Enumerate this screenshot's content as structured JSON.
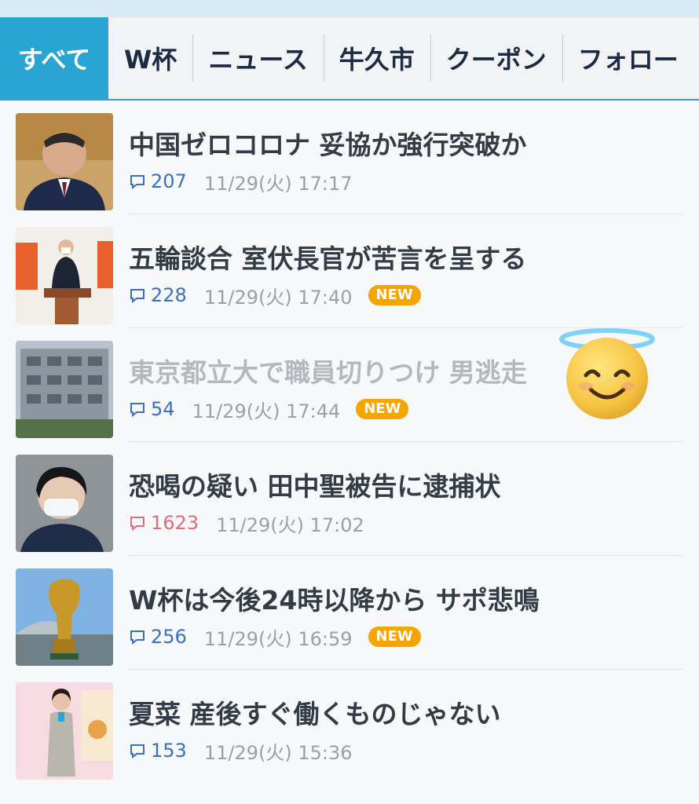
{
  "tabs": [
    {
      "label": "すべて",
      "active": true
    },
    {
      "label": "W杯"
    },
    {
      "label": "ニュース"
    },
    {
      "label": "牛久市"
    },
    {
      "label": "クーポン"
    },
    {
      "label": "フォロー"
    }
  ],
  "articles": [
    {
      "title": "中国ゼロコロナ 妥協か強行突破か",
      "comments": "207",
      "time": "11/29(火) 17:17",
      "new": false,
      "read": false,
      "thumb_desc": "portrait"
    },
    {
      "title": "五輪談合 室伏長官が苦言を呈する",
      "comments": "228",
      "time": "11/29(火) 17:40",
      "new": true,
      "read": false,
      "thumb_desc": "podium"
    },
    {
      "title": "東京都立大で職員切りつけ 男逃走",
      "comments": "54",
      "time": "11/29(火) 17:44",
      "new": true,
      "read": true,
      "thumb_desc": "building"
    },
    {
      "title": "恐喝の疑い 田中聖被告に逮捕状",
      "comments": "1623",
      "time": "11/29(火) 17:02",
      "new": false,
      "read": false,
      "hot": true,
      "thumb_desc": "masked-man"
    },
    {
      "title": "W杯は今後24時以降から サポ悲鳴",
      "comments": "256",
      "time": "11/29(火) 16:59",
      "new": true,
      "read": false,
      "thumb_desc": "trophy"
    },
    {
      "title": "夏菜 産後すぐ働くものじゃない",
      "comments": "153",
      "time": "11/29(火) 15:36",
      "new": false,
      "read": false,
      "thumb_desc": "woman-event"
    }
  ],
  "new_badge_label": "NEW",
  "colors": {
    "accent": "#2aa5d3",
    "badge": "#f5a400",
    "comment_blue": "#3b6fc1",
    "comment_hot": "#e56b7a"
  },
  "overlay_emoji": "smiling-face-with-halo"
}
